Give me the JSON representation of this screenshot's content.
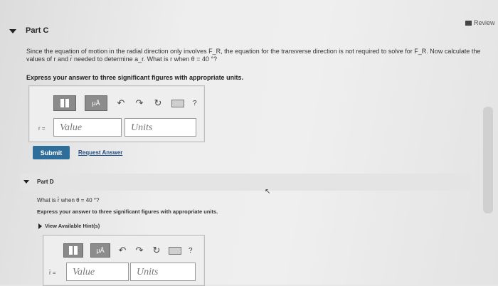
{
  "review": {
    "label": "Review"
  },
  "partC": {
    "title": "Part C",
    "paragraph": "Since the equation of motion in the radial direction only involves F_R, the equation for the transverse direction is not required to solve for F_R. Now calculate the values of r and r̈ needed to determine a_r. What is r when θ = 40 °?",
    "instruction": "Express your answer to three significant figures with appropriate units.",
    "toolbar": {
      "mu": "μÅ",
      "undo": "↶",
      "redo": "↷",
      "reset": "↻",
      "help": "?"
    },
    "inputLabel": "r =",
    "valuePlaceholder": "Value",
    "unitsPlaceholder": "Units",
    "submit": "Submit",
    "requestAnswer": "Request Answer"
  },
  "partD": {
    "title": "Part D",
    "question": "What is r̈ when θ = 40 °?",
    "instruction": "Express your answer to three significant figures with appropriate units.",
    "hints": "View Available Hint(s)",
    "toolbar": {
      "mu": "μÅ",
      "undo": "↶",
      "redo": "↷",
      "reset": "↻",
      "help": "?"
    },
    "inputLabel": "r̈ =",
    "valuePlaceholder": "Value",
    "unitsPlaceholder": "Units"
  }
}
